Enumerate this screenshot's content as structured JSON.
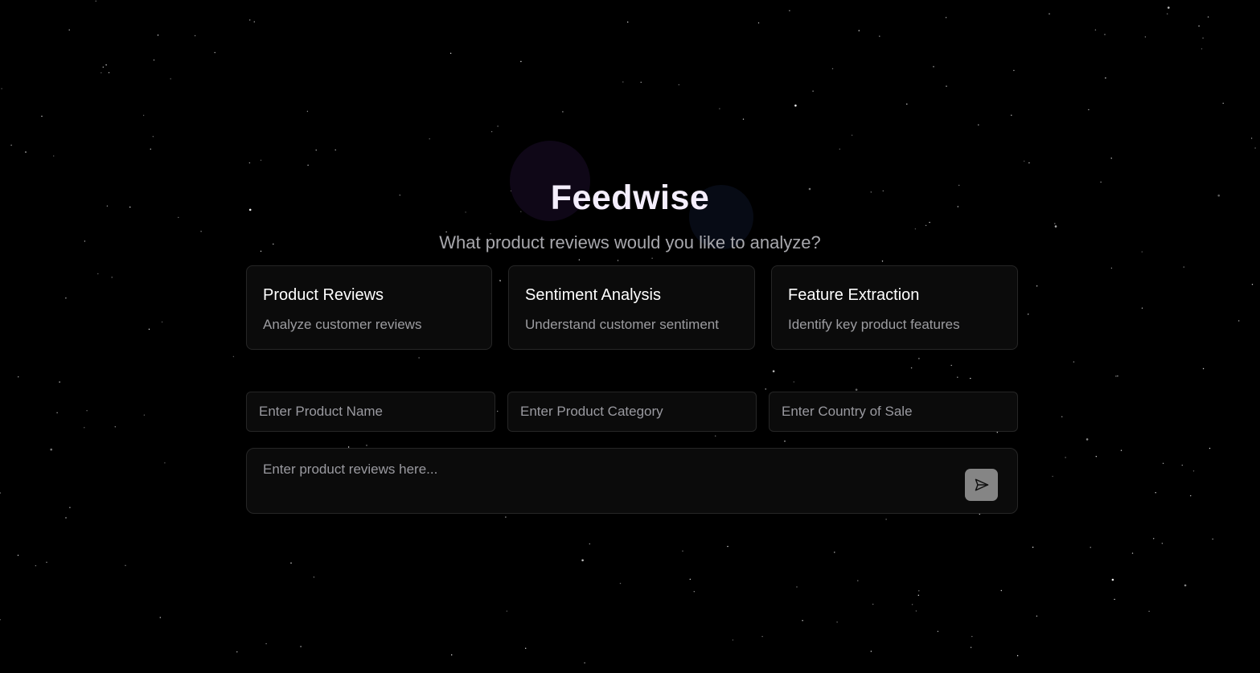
{
  "app": {
    "title": "Feedwise",
    "subtitle": "What product reviews would you like to analyze?"
  },
  "cards": [
    {
      "title": "Product Reviews",
      "description": "Analyze customer reviews"
    },
    {
      "title": "Sentiment Analysis",
      "description": "Understand customer sentiment"
    },
    {
      "title": "Feature Extraction",
      "description": "Identify key product features"
    }
  ],
  "form": {
    "product_name_placeholder": "Enter Product Name",
    "product_category_placeholder": "Enter Product Category",
    "country_placeholder": "Enter Country of Sale",
    "reviews_placeholder": "Enter product reviews here..."
  },
  "icons": {
    "send": "send-icon"
  },
  "colors": {
    "background": "#000000",
    "card_background": "#0b0b0b",
    "border": "#262626",
    "send_button": "#858585",
    "title": "#f4eefc"
  }
}
